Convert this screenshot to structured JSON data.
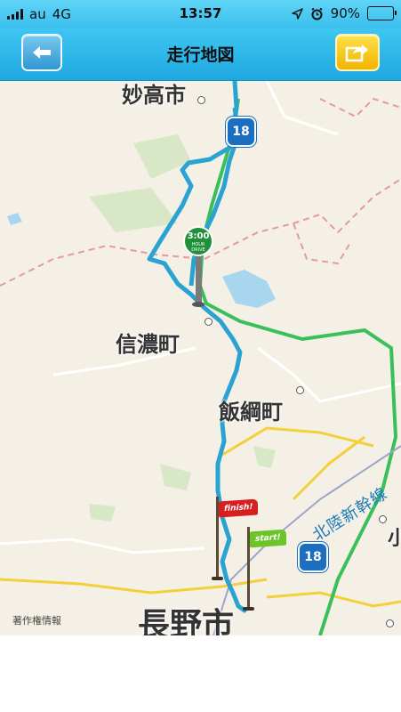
{
  "status_bar": {
    "carrier": "au",
    "network": "4G",
    "time": "13:57",
    "battery": "90%",
    "battery_level": 0.9,
    "icons": [
      "signal-bars-icon",
      "location-arrow-icon",
      "alarm-clock-icon",
      "battery-icon"
    ]
  },
  "nav": {
    "title": "走行地図",
    "back_icon": "arrow-left-icon",
    "share_icon": "share-arrow-icon"
  },
  "map": {
    "places": {
      "myoko": "妙高市",
      "shinano": "信濃町",
      "iizuna": "飯綱町",
      "nagano": "長野市",
      "edge": "小"
    },
    "routes": {
      "r18_top": "18",
      "r18_bottom": "18"
    },
    "railway": "北陸新幹線",
    "copyright": "著作権情報",
    "drive_badge": {
      "time": "3:00",
      "line1": "HOUR",
      "line2": "DRIVE"
    },
    "flags": {
      "finish": "finish!",
      "start": "start!"
    },
    "colors": {
      "track": "#2aa3d2",
      "background": "#f5f0e6",
      "highway": "#3bbf5a",
      "major_road": "#f4cf3a",
      "water": "#a9d6ef",
      "border": "#e59a9a"
    }
  }
}
